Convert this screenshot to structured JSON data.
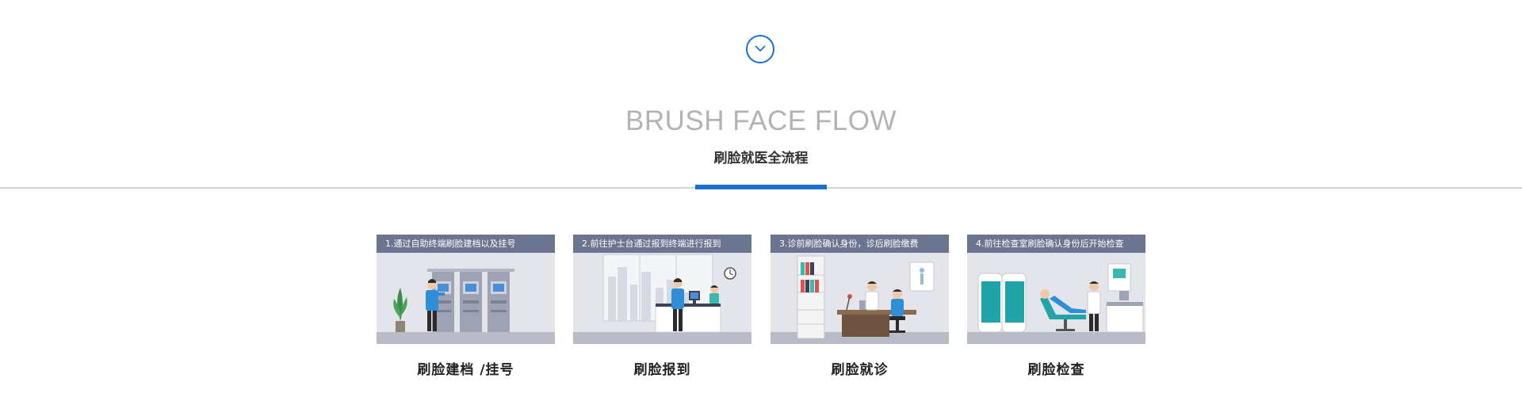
{
  "section": {
    "title_en": "BRUSH FACE FLOW",
    "title_cn": "刷脸就医全流程"
  },
  "colors": {
    "accent": "#1a73c9",
    "card_header": "#6c7590",
    "illustration_bg": "#e4e5ea",
    "teal": "#1fa5a8"
  },
  "icons": {
    "scroll_down": "chevron-down-icon"
  },
  "steps": [
    {
      "header": "1.通过自助终端刷脸建档以及挂号",
      "label": "刷脸建档 /挂号",
      "scene": "self-service-kiosks"
    },
    {
      "header": "2.前往护士台通过报到终端进行报到",
      "label": "刷脸报到",
      "scene": "nurse-station"
    },
    {
      "header": "3.诊前刷脸确认身份，诊后刷脸缴费",
      "label": "刷脸就诊",
      "scene": "doctor-office"
    },
    {
      "header": "4.前往检查室刷脸确认身份后开始检查",
      "label": "刷脸检查",
      "scene": "examination-room"
    }
  ]
}
